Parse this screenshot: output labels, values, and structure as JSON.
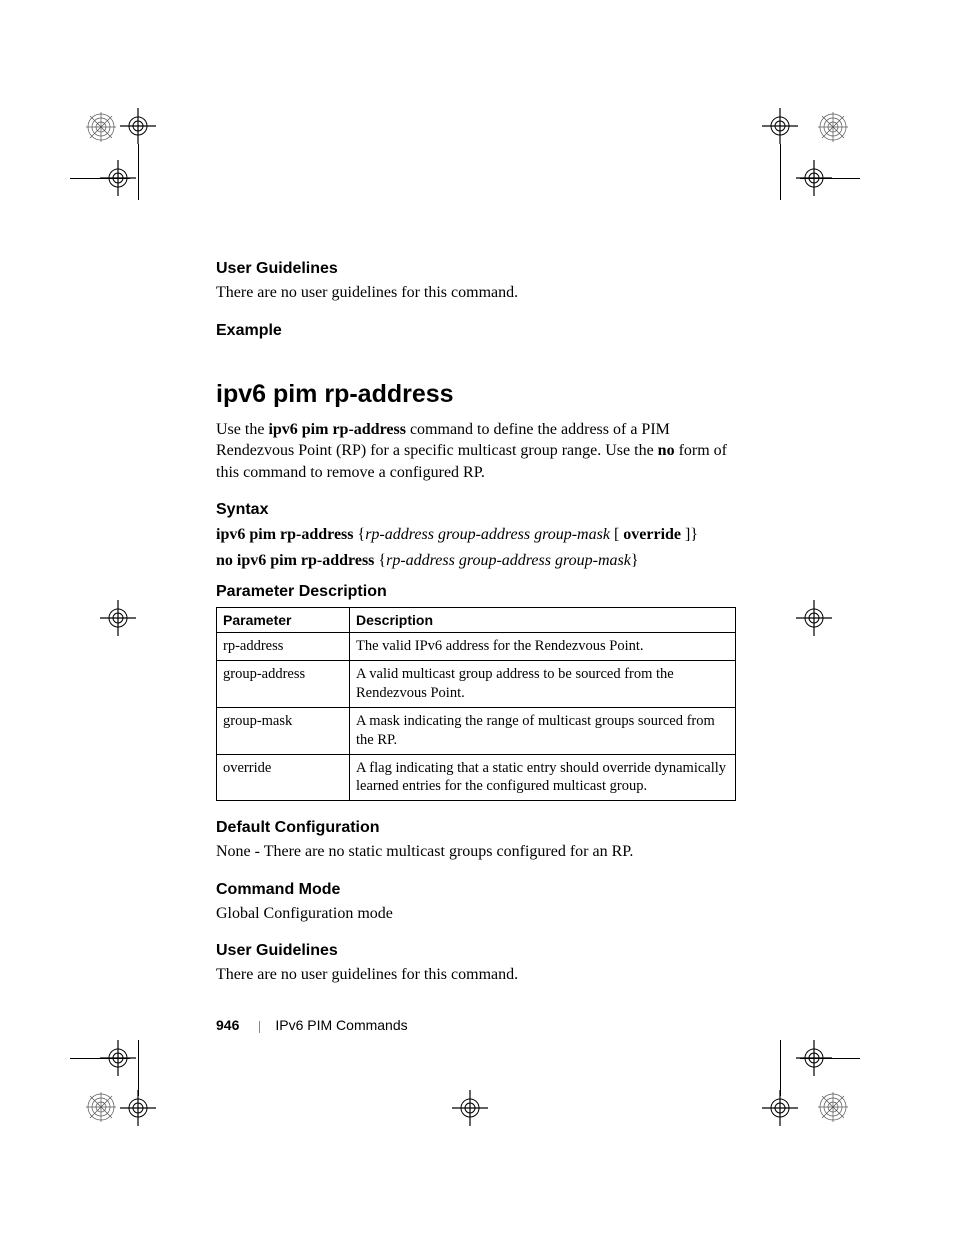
{
  "sections": {
    "ug1_head": "User Guidelines",
    "ug1_body": "There are no user guidelines for this command.",
    "ex_head": "Example",
    "cmd_title": "ipv6 pim rp-address",
    "intro_pre": "Use the ",
    "intro_cmd": "ipv6 pim rp-address",
    "intro_mid": " command to define the address of a PIM Rendezvous Point (RP) for a specific multicast group range. Use the ",
    "intro_no": "no",
    "intro_post": " form of this command to remove a configured RP.",
    "syntax_head": "Syntax",
    "syntax1_cmd": "ipv6 pim rp-address",
    "syntax1_args": "rp-address group-address group-mask",
    "syntax1_override": "override",
    "syntax2_cmd": "no ipv6 pim rp-address",
    "syntax2_args": "rp-address group-address group-mask",
    "pd_head": "Parameter Description",
    "dc_head": "Default Configuration",
    "dc_body": "None - There are no static multicast groups configured for an RP.",
    "cm_head": "Command Mode",
    "cm_body": "Global Configuration mode",
    "ug2_head": "User Guidelines",
    "ug2_body": "There are no user guidelines for this command."
  },
  "table": {
    "h1": "Parameter",
    "h2": "Description",
    "rows": [
      {
        "p": "rp-address",
        "d": "The valid IPv6 address for the Rendezvous Point."
      },
      {
        "p": "group-address",
        "d": "A valid multicast group address to be sourced from the Rendezvous Point."
      },
      {
        "p": "group-mask",
        "d": "A mask indicating the range of multicast groups sourced from the RP."
      },
      {
        "p": "override",
        "d": "A flag indicating that a static entry should override dynamically learned entries for the configured multicast group."
      }
    ]
  },
  "footer": {
    "page": "946",
    "chapter": "IPv6 PIM Commands"
  }
}
